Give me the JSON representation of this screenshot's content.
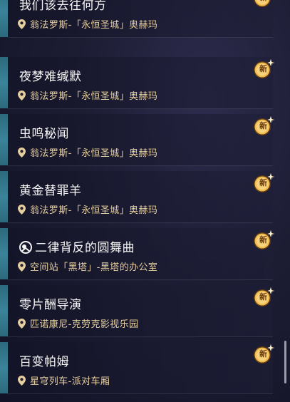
{
  "quests": [
    {
      "title": "我们该去往何方",
      "location": "翁法罗斯-「永恒圣城」奥赫玛",
      "badge": "新",
      "icon": ""
    },
    {
      "title": "夜梦难缄默",
      "location": "翁法罗斯-「永恒圣城」奥赫玛",
      "badge": "新",
      "icon": ""
    },
    {
      "title": "虫鸣秘闻",
      "location": "翁法罗斯-「永恒圣城」奥赫玛",
      "badge": "新",
      "icon": ""
    },
    {
      "title": "黄金替罪羊",
      "location": "翁法罗斯-「永恒圣城」奥赫玛",
      "badge": "新",
      "icon": ""
    },
    {
      "title": "二律背反的圆舞曲",
      "location": "空间站「黑塔」-黑塔的办公室",
      "badge": "新",
      "icon": "herta-quest-icon"
    },
    {
      "title": "零片酬导演",
      "location": "匹诺康尼-克劳克影视乐园",
      "badge": "新",
      "icon": ""
    },
    {
      "title": "百变帕姆",
      "location": "星穹列车-派对车厢",
      "badge": "新",
      "icon": ""
    }
  ],
  "colors": {
    "title": "#f5f5f5",
    "location": "#e6cf9f",
    "accent_bar": "#3a8399",
    "badge_gold": "#f0b94a"
  },
  "icons": {
    "location": "map-pin-icon",
    "badge": "new-badge-icon"
  }
}
